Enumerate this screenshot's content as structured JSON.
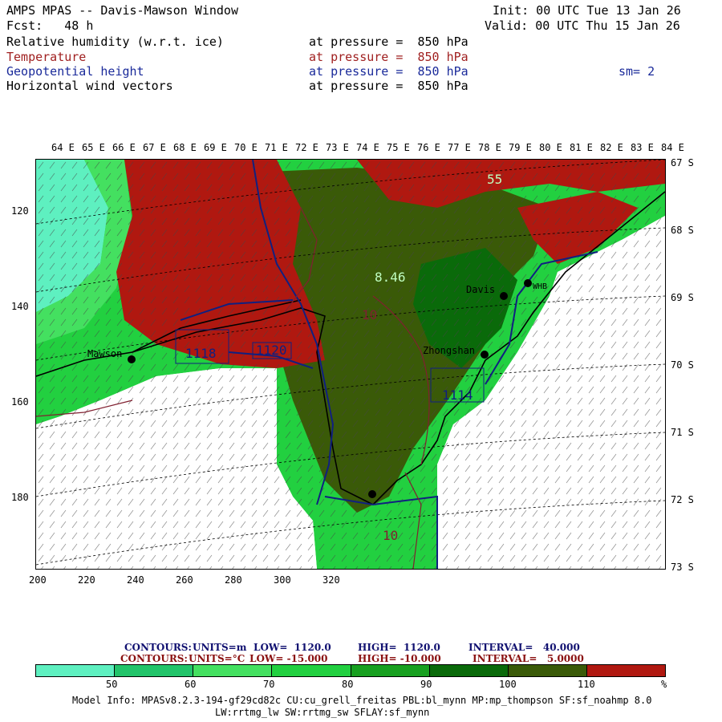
{
  "header": {
    "title": "AMPS MPAS -- Davis-Mawson Window",
    "fcst": "Fcst:   48 h",
    "init": "Init: 00 UTC Tue 13 Jan 26",
    "valid": "Valid: 00 UTC Thu 15 Jan 26",
    "fields": [
      {
        "name": "Relative humidity (w.r.t. ice)",
        "level": "at pressure =  850 hPa"
      },
      {
        "name": "Temperature",
        "level": "at pressure =  850 hPa"
      },
      {
        "name": "Geopotential height",
        "level": "at pressure =  850 hPa"
      },
      {
        "name": "Horizontal wind vectors",
        "level": "at pressure =  850 hPa"
      }
    ],
    "smoothing": "sm= 2"
  },
  "map": {
    "lon_labels": [
      "64 E",
      "65 E",
      "66 E",
      "67 E",
      "68 E",
      "69 E",
      "70 E",
      "71 E",
      "72 E",
      "73 E",
      "74 E",
      "75 E",
      "76 E",
      "77 E",
      "78 E",
      "79 E",
      "80 E",
      "81 E",
      "82 E",
      "83 E",
      "84 E"
    ],
    "lat_labels": [
      "67 S",
      "68 S",
      "69 S",
      "70 S",
      "71 S",
      "72 S",
      "73 S"
    ],
    "y_ticks": [
      "120",
      "140",
      "160",
      "180"
    ],
    "x_ticks": [
      "200",
      "220",
      "240",
      "260",
      "280",
      "300",
      "320"
    ],
    "stations": [
      {
        "name": "Mawson"
      },
      {
        "name": "Davis"
      },
      {
        "name": "WHB"
      },
      {
        "name": "Zhongshan"
      }
    ],
    "contour_labels": [
      "1118",
      "1120",
      "1114",
      "8.46",
      "10",
      "10",
      "55"
    ],
    "colors": {
      "rh_40_50": "#5ef0c0",
      "rh_50_60": "#22c46a",
      "rh_60_70": "#44e060",
      "rh_70_80": "#22d040",
      "rh_80_90": "#18a020",
      "rh_90_100": "#0a6a0a",
      "rh_100_110": "#3a5a08",
      "rh_110": "#b01810",
      "height": "#102080",
      "temp": "#802030"
    }
  },
  "legend": {
    "contours_height": {
      "label": "CONTOURS:",
      "units": "UNITS=m",
      "low": "LOW=  1120.0",
      "high": "HIGH=  1120.0",
      "interval": "INTERVAL=   40.000"
    },
    "contours_temp": {
      "label": "CONTOURS:",
      "units": "UNITS=°C",
      "low": "LOW= -15.000",
      "high": "HIGH= -10.000",
      "interval": "INTERVAL=   5.0000"
    },
    "colorbar_colors": [
      "#5ef0c0",
      "#22c46a",
      "#44e060",
      "#22d040",
      "#18a020",
      "#0a6a0a",
      "#3a5a08",
      "#b01810"
    ],
    "colorbar_labels": [
      "50",
      "60",
      "70",
      "80",
      "90",
      "100",
      "110",
      "%"
    ]
  },
  "footer": {
    "line1": "Model Info: MPASv8.2.3-194-gf29cd82c CU:cu_grell_freitas PBL:bl_mynn MP:mp_thompson SF:sf_noahmp 8.0",
    "line2": "LW:rrtmg_lw SW:rrtmg_sw SFLAY:sf_mynn"
  }
}
